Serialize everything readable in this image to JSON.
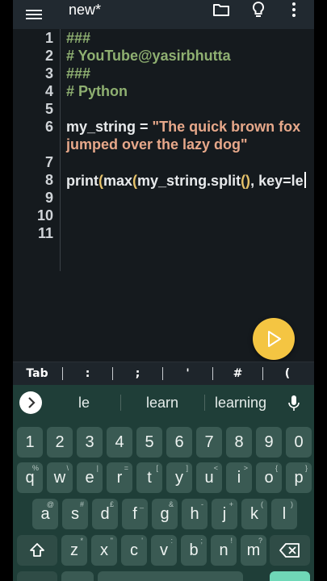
{
  "topbar": {
    "title": "new*",
    "menu_icon": "hamburger-menu-icon",
    "icons": [
      "folder-icon",
      "lightbulb-icon",
      "more-vert-icon"
    ]
  },
  "editor": {
    "line_numbers": [
      "1",
      "2",
      "3",
      "4",
      "5",
      "6",
      "7",
      "8",
      "9",
      "10",
      "11"
    ],
    "lines": {
      "l1": "###",
      "l2": "# YouTube@yasirbhutta",
      "l3": "###",
      "l4": "# Python",
      "l6a": "my_string = ",
      "l6b": "\"The quick brown fox",
      "l6c": "jumped over the lazy dog\"",
      "l8a": "print",
      "l8b": "(",
      "l8c": "max",
      "l8d": "(",
      "l8e": "my_string.split",
      "l8f": "()",
      "l8g": ", key=le"
    }
  },
  "run_button": {
    "icon": "play-icon"
  },
  "symbol_bar": [
    "Tab",
    ":",
    ";",
    "'",
    "#",
    "("
  ],
  "keyboard": {
    "suggestions": [
      "le",
      "learn",
      "learning"
    ],
    "mic_icon": "microphone-icon",
    "expand_icon": "chevron-right-icon",
    "numbers": [
      "1",
      "2",
      "3",
      "4",
      "5",
      "6",
      "7",
      "8",
      "9",
      "0"
    ],
    "row1": [
      {
        "k": "q",
        "h": "%"
      },
      {
        "k": "w",
        "h": "\\"
      },
      {
        "k": "e",
        "h": "|"
      },
      {
        "k": "r",
        "h": "="
      },
      {
        "k": "t",
        "h": "["
      },
      {
        "k": "y",
        "h": "]"
      },
      {
        "k": "u",
        "h": "<"
      },
      {
        "k": "i",
        "h": ">"
      },
      {
        "k": "o",
        "h": "{"
      },
      {
        "k": "p",
        "h": "}"
      }
    ],
    "row2": [
      {
        "k": "a",
        "h": "@"
      },
      {
        "k": "s",
        "h": "#"
      },
      {
        "k": "d",
        "h": "£"
      },
      {
        "k": "f",
        "h": "_"
      },
      {
        "k": "g",
        "h": "&"
      },
      {
        "k": "h",
        "h": "-"
      },
      {
        "k": "j",
        "h": "+"
      },
      {
        "k": "k",
        "h": "("
      },
      {
        "k": "l",
        "h": ")"
      }
    ],
    "row3": [
      {
        "k": "z",
        "h": "*"
      },
      {
        "k": "x",
        "h": "\""
      },
      {
        "k": "c",
        "h": "'"
      },
      {
        "k": "v",
        "h": ":"
      },
      {
        "k": "b",
        "h": ";"
      },
      {
        "k": "n",
        "h": "!"
      },
      {
        "k": "m",
        "h": "?"
      }
    ],
    "shift_icon": "shift-icon",
    "backspace_icon": "backspace-icon"
  },
  "colors": {
    "accent": "#f4c542",
    "keyboard_bg": "#1f3e38",
    "key_bg": "#3a5a53",
    "comment": "#8fb071",
    "string": "#e7a88a"
  }
}
